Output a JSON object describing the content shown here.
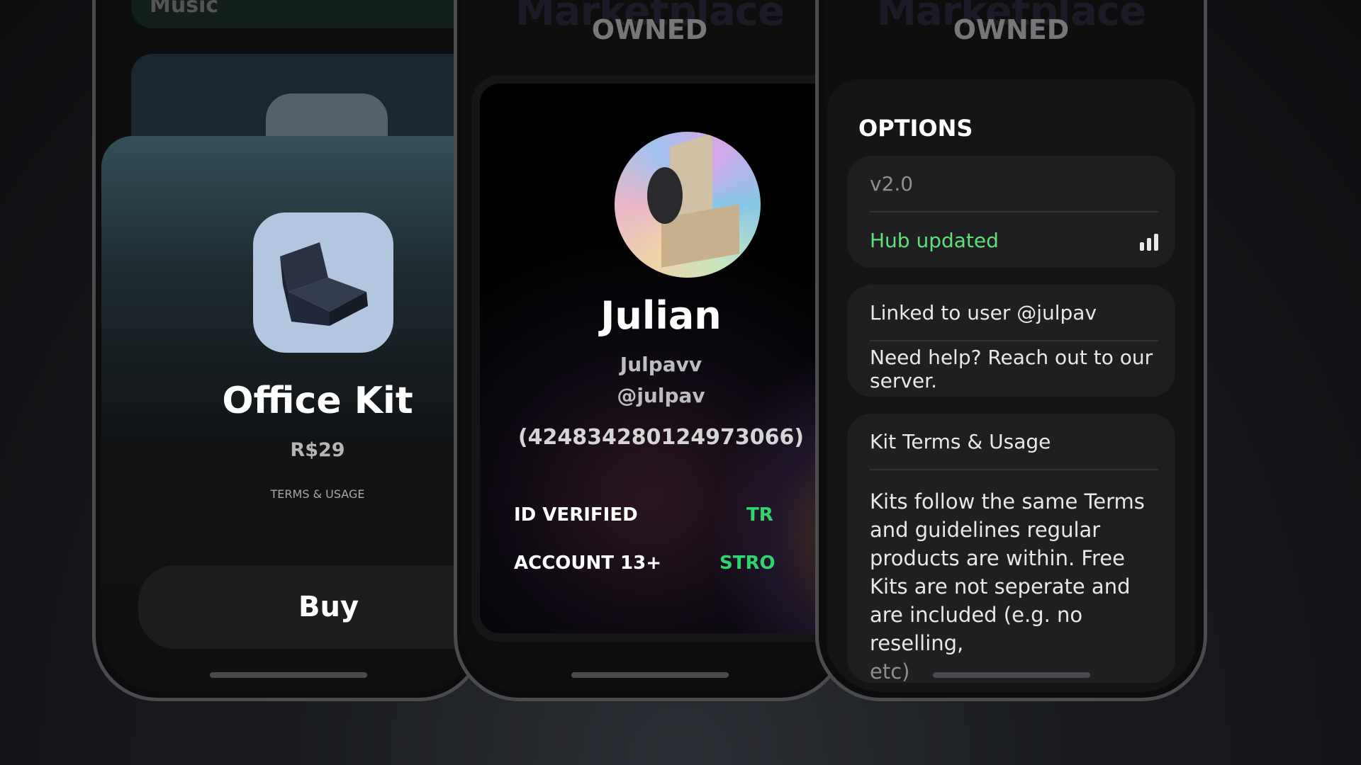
{
  "phone1": {
    "top_label": "Music",
    "product": {
      "name": "Office Kit",
      "price": "R$29",
      "terms_link": "TERMS & USAGE",
      "buy_label": "Buy",
      "icon": "chair-icon",
      "icon_bg": "#b3c6df"
    }
  },
  "phone2": {
    "bg_header": "Marketplace",
    "bg_tab": "OWNED",
    "profile": {
      "name": "Julian",
      "display_name": "Julpavv",
      "handle": "@julpav",
      "user_id": "(4248342801249730​66)",
      "badges": [
        {
          "label": "ID VERIFIED",
          "color": "#ffffff"
        },
        {
          "label": "TR",
          "color": "#2fd66e"
        },
        {
          "label": "ACCOUNT 13+",
          "color": "#ffffff"
        },
        {
          "label": "STRO",
          "color": "#2fd66e"
        }
      ]
    }
  },
  "phone3": {
    "bg_header": "Marketplace",
    "bg_tab": "OWNED",
    "title": "OPTIONS",
    "version_group": {
      "version": "v2.0",
      "status": "Hub updated",
      "status_color": "#5de07c"
    },
    "link_group": {
      "linked": "Linked to user @julpav",
      "help": "Need help? Reach out to our server."
    },
    "terms_group": {
      "heading": "Kit Terms & Usage",
      "body": "Kits follow the same Terms and guidelines regular products are within. Free Kits are not seperate and are included (e.g. no reselling,",
      "body_tail": "etc)"
    }
  }
}
